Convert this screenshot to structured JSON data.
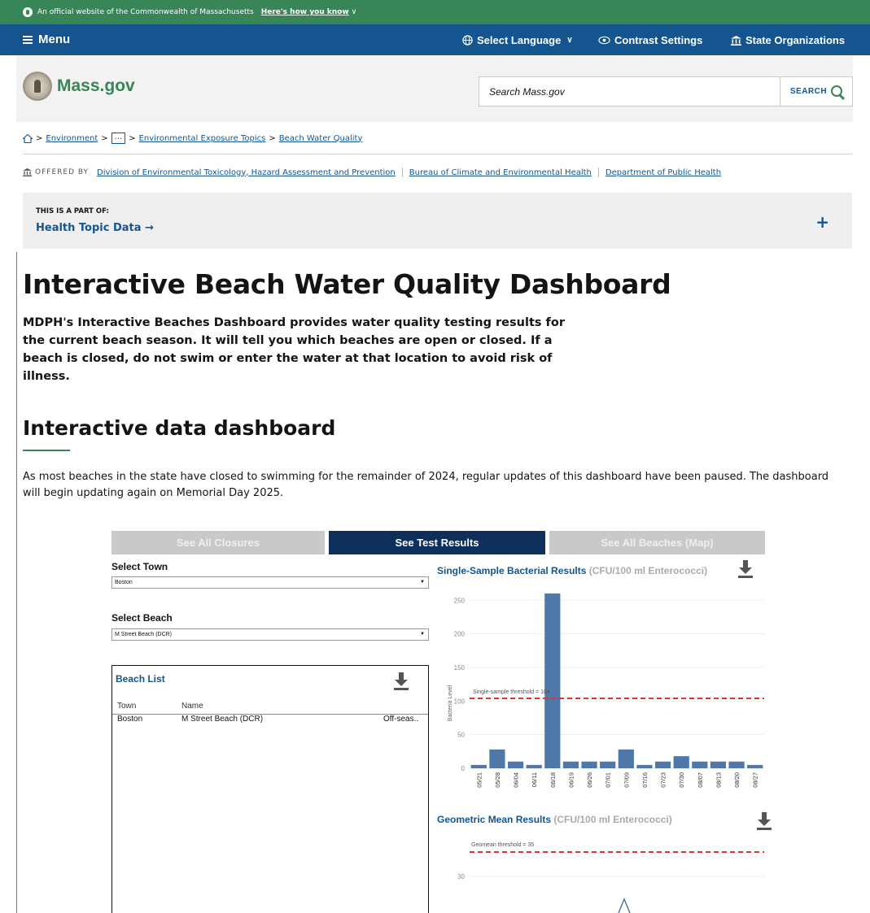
{
  "official_banner": {
    "text": "An official website of the Commonwealth of Massachusetts",
    "how_link": "Here's how you know",
    "how_chevron": "∨"
  },
  "navbar": {
    "menu_label": "Menu",
    "language_label": "Select Language",
    "language_chevron": "∨",
    "contrast_label": "Contrast Settings",
    "orgs_label": "State Organizations"
  },
  "header": {
    "logo_text": "Mass.gov",
    "search_placeholder": "Search Mass.gov",
    "search_button": "SEARCH"
  },
  "breadcrumb": {
    "items": [
      "Environment",
      "...",
      "Environmental Exposure Topics",
      "Beach Water Quality"
    ],
    "separator": ">"
  },
  "offered_by": {
    "label": "OFFERED BY",
    "orgs": [
      "Division of Environmental Toxicology, Hazard Assessment and Prevention",
      "Bureau of Climate and Environmental Health",
      "Department of Public Health"
    ]
  },
  "part_of": {
    "label": "THIS IS A PART OF:",
    "link": "Health Topic Data →",
    "toggle": "+"
  },
  "content": {
    "title": "Interactive Beach Water Quality Dashboard",
    "intro": "MDPH's Interactive Beaches Dashboard provides water quality testing results for the current beach season. It will tell you which beaches are open or closed. If a beach is closed, do not swim or enter the water at that location to avoid risk of illness.",
    "section_title": "Interactive data dashboard",
    "notice": "As most beaches in the state have closed to swimming for the remainder of 2024, regular updates of this dashboard have been paused. The dashboard will begin updating again on Memorial Day 2025."
  },
  "dashboard": {
    "tabs": [
      "See All Closures",
      "See Test Results",
      "See All Beaches (Map)"
    ],
    "active_tab": "See Test Results",
    "select_town_label": "Select Town",
    "select_town_value": "Boston",
    "select_beach_label": "Select Beach",
    "select_beach_value": "M Street Beach (DCR)",
    "beach_list": {
      "title": "Beach List",
      "columns": [
        "Town",
        "Name"
      ],
      "rows": [
        {
          "town": "Boston",
          "name": "M Street Beach (DCR)",
          "status": "Off-seas.."
        }
      ]
    }
  },
  "chart_data": [
    {
      "type": "bar",
      "title": "Single-Sample Bacterial Results",
      "unit_label": "(CFU/100 ml Enterococci)",
      "ylabel": "Bacteria Level",
      "ylim": [
        0,
        260
      ],
      "yticks": [
        0,
        50,
        100,
        150,
        200,
        250
      ],
      "threshold": 104,
      "threshold_label": "Single-sample threshold = 104",
      "categories": [
        "05/21",
        "05/28",
        "06/04",
        "06/11",
        "06/18",
        "06/19",
        "06/26",
        "07/01",
        "07/09",
        "07/16",
        "07/23",
        "07/30",
        "08/07",
        "08/13",
        "08/20",
        "08/27"
      ],
      "values": [
        5,
        28,
        10,
        5,
        260,
        10,
        10,
        10,
        28,
        5,
        10,
        18,
        10,
        10,
        10,
        5
      ],
      "colors": {
        "bar": "#4f78a8",
        "threshold": "#e03030",
        "grid": "#eeeeee"
      }
    },
    {
      "type": "line",
      "title": "Geometric Mean Results",
      "unit_label": "(CFU/100 ml Enterococci)",
      "threshold": 35,
      "threshold_label": "Geomean threshold = 35",
      "yticks": [
        30
      ],
      "colors": {
        "line": "#4f78a8",
        "threshold": "#e03030"
      }
    }
  ]
}
